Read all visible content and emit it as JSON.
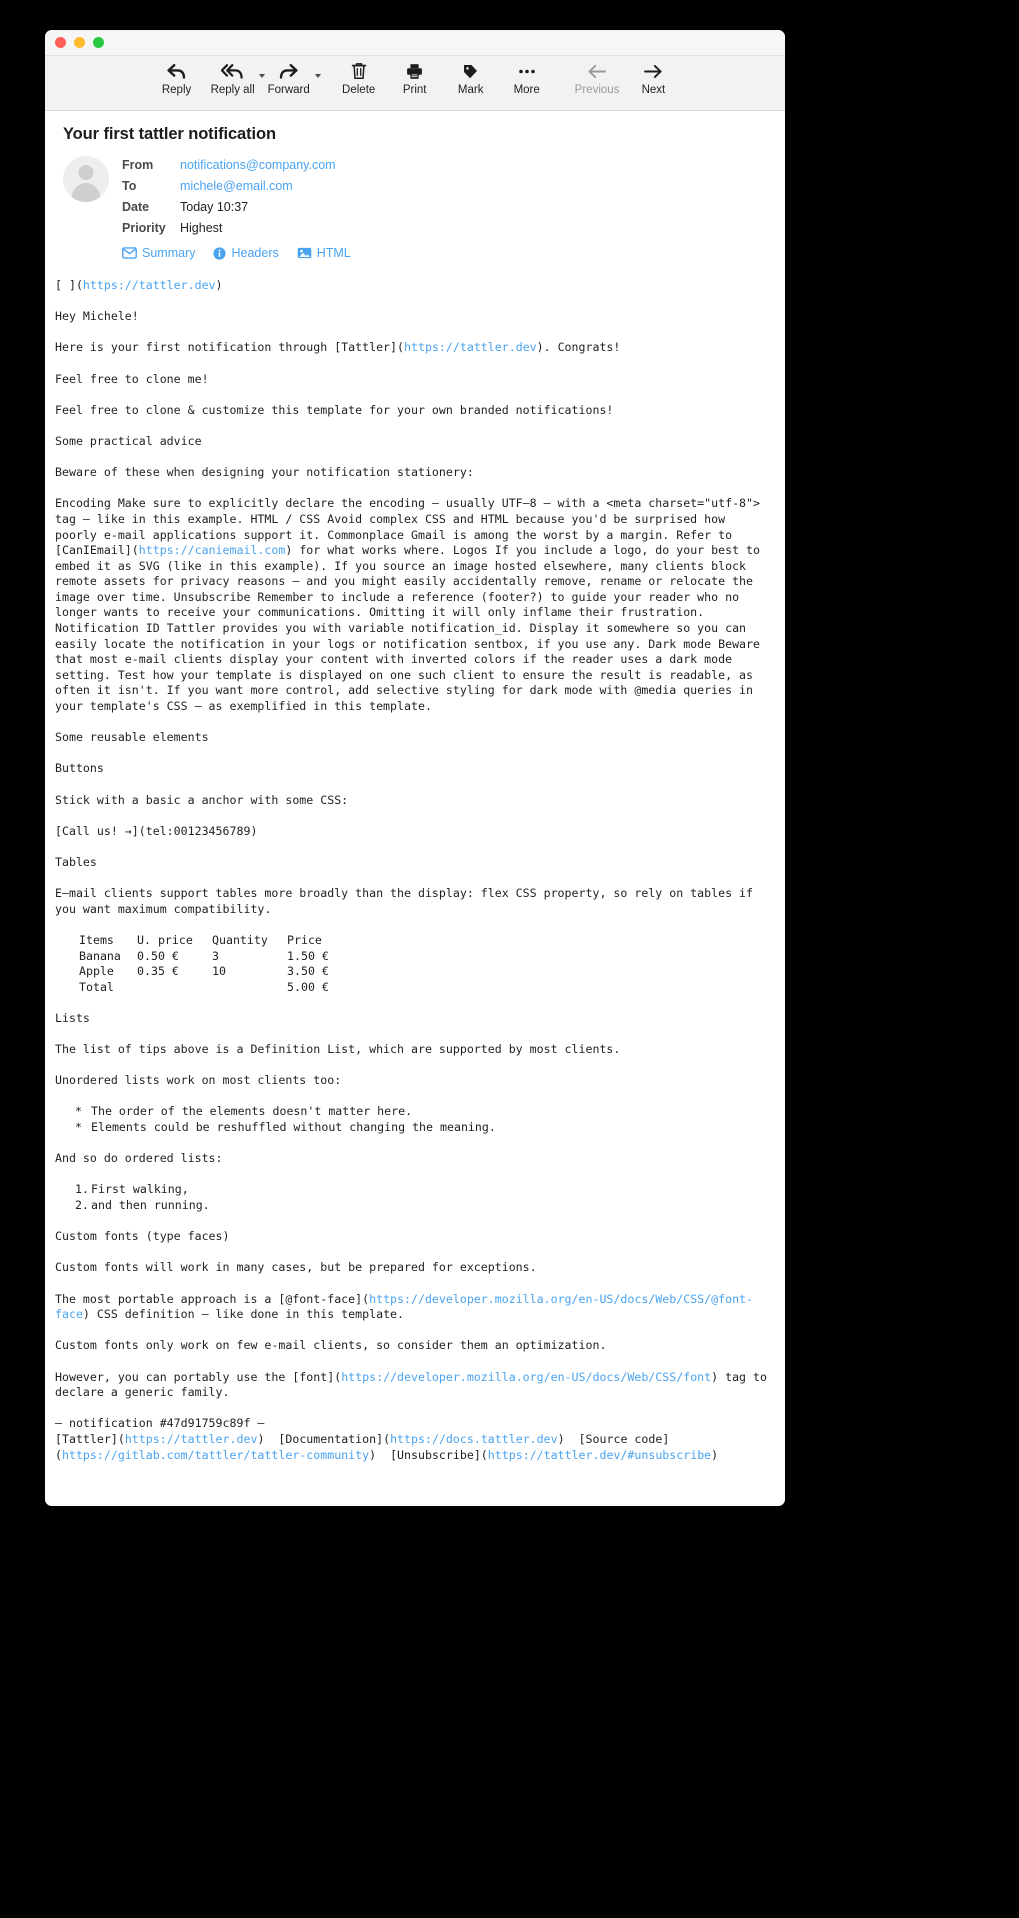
{
  "window": {
    "traffic_lights": [
      "close",
      "minimize",
      "zoom"
    ]
  },
  "toolbar": {
    "items": [
      {
        "label": "Reply",
        "icon": "reply-icon",
        "disabled": false,
        "caret": false
      },
      {
        "label": "Reply all",
        "icon": "reply-all-icon",
        "disabled": false,
        "caret": true
      },
      {
        "label": "Forward",
        "icon": "forward-icon",
        "disabled": false,
        "caret": true
      },
      {
        "label": "Delete",
        "icon": "trash-icon",
        "disabled": false,
        "caret": false
      },
      {
        "label": "Print",
        "icon": "printer-icon",
        "disabled": false,
        "caret": false
      },
      {
        "label": "Mark",
        "icon": "tag-icon",
        "disabled": false,
        "caret": false
      },
      {
        "label": "More",
        "icon": "ellipsis-icon",
        "disabled": false,
        "caret": false
      },
      {
        "label": "Previous",
        "icon": "arrow-left-icon",
        "disabled": true,
        "caret": false
      },
      {
        "label": "Next",
        "icon": "arrow-right-icon",
        "disabled": false,
        "caret": false
      }
    ]
  },
  "message": {
    "subject": "Your first tattler notification",
    "fields": [
      {
        "label": "From",
        "value": "notifications@company.com",
        "is_link": true
      },
      {
        "label": "To",
        "value": "michele@email.com",
        "is_link": true
      },
      {
        "label": "Date",
        "value": "Today 10:37",
        "is_link": false
      },
      {
        "label": "Priority",
        "value": "Highest",
        "is_link": false
      }
    ],
    "tabs": [
      {
        "label": "Summary",
        "icon": "envelope-icon"
      },
      {
        "label": "Headers",
        "icon": "info-icon"
      },
      {
        "label": "HTML",
        "icon": "image-icon"
      }
    ]
  },
  "body": {
    "logo_line_pre": "[ ](",
    "logo_line_url": "https://tattler.dev",
    "logo_line_post": ")",
    "greeting": "Hey Michele!",
    "intro_pre": "Here is your first notification through [Tattler](",
    "intro_url": "https://tattler.dev",
    "intro_post": "). Congrats!",
    "clone_me": "Feel free to clone me!",
    "clone_customize": "Feel free to clone & customize this template for your own branded notifications!",
    "heading_advice": "Some practical advice",
    "advice_intro": "Beware of these when designing your notification stationery:",
    "advice_p1": "Encoding Make sure to explicitly declare the encoding — usually UTF–8 — with a <meta charset=\"utf-8\"> tag — like in this example. HTML / CSS Avoid complex CSS and HTML because you'd be surprised how poorly e-mail applications support it. Commonplace Gmail is among the worst by a margin. Refer to [CanIEmail](",
    "advice_p1_url": "https://caniemail.com",
    "advice_p1_post": ") for what works where. Logos If you include a logo, do your best to embed it as SVG (like in this example). If you source an image hosted elsewhere, many clients block remote assets for privacy reasons — and you might easily accidentally remove, rename or relocate the image over time. Unsubscribe Remember to include a reference (footer?) to guide your reader who no longer wants to receive your communications. Omitting it will only inflame their frustration. Notification ID Tattler provides you with variable notification_id. Display it somewhere so you can easily locate the notification in your logs or notification sentbox, if you use any. Dark mode Beware that most e-mail clients display your content with inverted colors if the reader uses a dark mode setting. Test how your template is displayed on one such client to ensure the result is readable, as often it isn't. If you want more control, add selective styling for dark mode with @media queries in your template's CSS — as exemplified in this template.",
    "heading_reusable": "Some reusable elements",
    "heading_buttons": "Buttons",
    "buttons_text": "Stick with a basic a anchor with some CSS:",
    "call_us_link": "[Call us! →](tel:00123456789)",
    "heading_tables": "Tables",
    "tables_text": "E–mail clients support tables more broadly than the display: flex CSS property, so rely on tables if you want maximum compatibility.",
    "table": {
      "headers": [
        "Items",
        "U. price",
        "Quantity",
        "Price"
      ],
      "rows": [
        [
          "Banana",
          "0.50 €",
          "3",
          "1.50 €"
        ],
        [
          "Apple",
          "0.35 €",
          "10",
          "3.50 €"
        ],
        [
          "Total",
          "",
          "",
          "5.00 €"
        ]
      ]
    },
    "heading_lists": "Lists",
    "lists_def": "The list of tips above is a Definition List, which are supported by most clients.",
    "lists_unordered_intro": "Unordered lists work on most clients too:",
    "unordered_items": [
      {
        "marker": "*",
        "text": "The order of the elements doesn't matter here."
      },
      {
        "marker": "*",
        "text": "Elements could be reshuffled without changing the meaning."
      }
    ],
    "lists_ordered_intro": "And so do ordered lists:",
    "ordered_items": [
      {
        "marker": "1.",
        "text": "First walking,"
      },
      {
        "marker": "2.",
        "text": "and then running."
      }
    ],
    "heading_fonts": "Custom fonts (type faces)",
    "fonts_p1": "Custom fonts will work in many cases, but be prepared for exceptions.",
    "fonts_p2_pre": "The most portable approach is a [@font-face](",
    "fonts_p2_url": "https://developer.mozilla.org/en-US/docs/Web/CSS/@font-face",
    "fonts_p2_post": ") CSS definition — like done in this template.",
    "fonts_p3": "Custom fonts only work on few e-mail clients, so consider them an optimization.",
    "fonts_p4_pre": "However, you can portably use the [font](",
    "fonts_p4_url": "https://developer.mozilla.org/en-US/docs/Web/CSS/font",
    "fonts_p4_post": ") tag to declare a generic family.",
    "footer_id": "— notification #47d91759c89f —",
    "footer_tattler_pre": "[Tattler](",
    "footer_tattler_url": "https://tattler.dev",
    "footer_tattler_post": ")",
    "footer_docs_pre": "[Documentation](",
    "footer_docs_url": "https://docs.tattler.dev",
    "footer_docs_post": ")",
    "footer_source_pre": "[Source code](",
    "footer_source_url": "https://gitlab.com/tattler/tattler-community",
    "footer_source_post": ")",
    "footer_unsub_pre": "[Unsubscribe](",
    "footer_unsub_url": "https://tattler.dev/#unsubscribe",
    "footer_unsub_post": ")"
  },
  "colors": {
    "link": "#4aa3f0",
    "text": "#1f1f1f",
    "toolbar_bg": "#f2f2f2",
    "titlebar_bg": "#f6f6f6"
  }
}
